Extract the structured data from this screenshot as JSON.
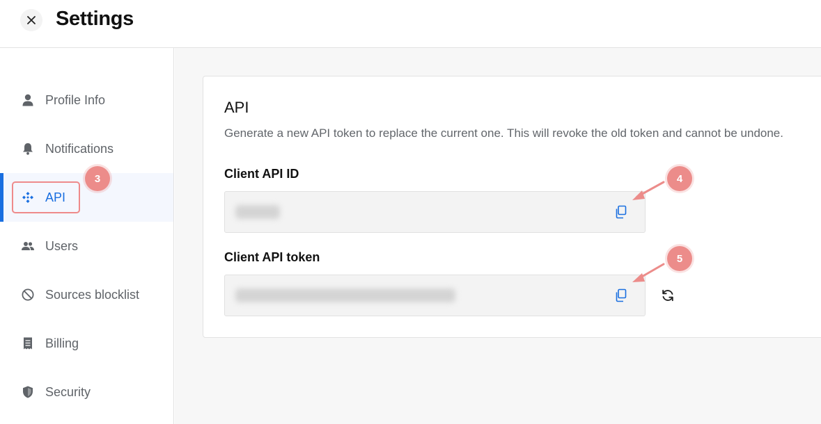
{
  "header": {
    "title": "Settings"
  },
  "sidebar": {
    "items": [
      {
        "label": "Profile Info",
        "icon": "person-icon"
      },
      {
        "label": "Notifications",
        "icon": "bell-icon"
      },
      {
        "label": "API",
        "icon": "api-icon"
      },
      {
        "label": "Users",
        "icon": "users-icon"
      },
      {
        "label": "Sources blocklist",
        "icon": "block-icon"
      },
      {
        "label": "Billing",
        "icon": "receipt-icon"
      },
      {
        "label": "Security",
        "icon": "shield-icon"
      }
    ],
    "active": "API"
  },
  "api": {
    "title": "API",
    "description": "Generate a new API token to replace the current one. This will revoke the old token and cannot be undone.",
    "client_id_label": "Client API ID",
    "client_token_label": "Client API token"
  },
  "annotations": {
    "step_3": "3",
    "step_4": "4",
    "step_5": "5"
  },
  "colors": {
    "accent": "#1a6fe0",
    "annotation": "#ec8c8a"
  }
}
